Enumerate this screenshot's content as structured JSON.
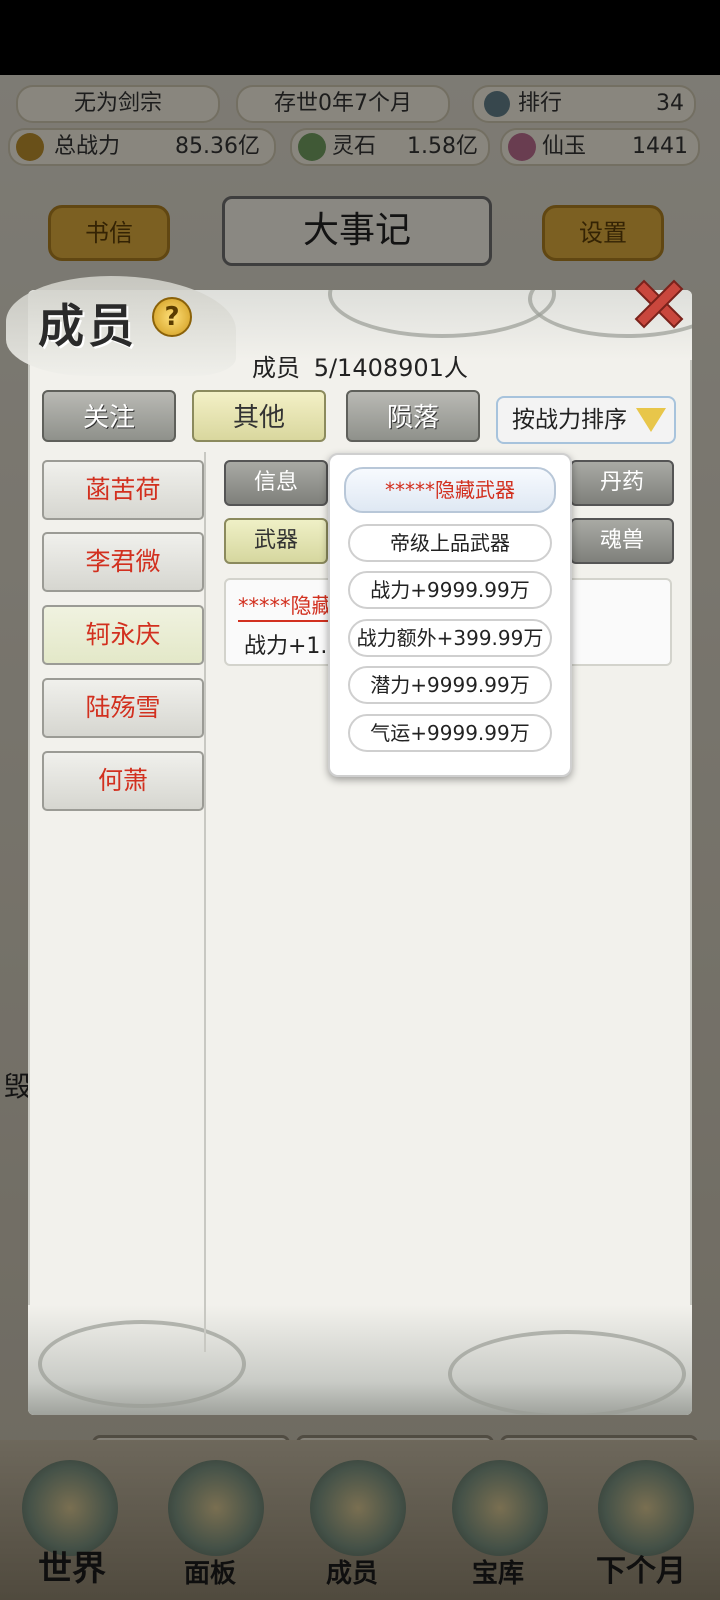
{
  "background_screen": {
    "sect_name": "无为剑宗",
    "age_text": "存世0年7个月",
    "rank_label": "排行",
    "rank_value": "34",
    "power_label": "总战力",
    "power_value": "85.36亿",
    "spirit_stone_label": "灵石",
    "spirit_stone_value": "1.58亿",
    "jade_label": "仙玉",
    "jade_value": "1441",
    "letters_button": "书信",
    "events_title": "大事记",
    "settings_button": "设置",
    "partial_char": "毁",
    "bottom_nav": [
      "世界",
      "面板",
      "成员",
      "宝库",
      "下个月"
    ]
  },
  "members_panel": {
    "title": "成员",
    "count_label": "成员",
    "count_value": "5/1408901人",
    "tabs": [
      {
        "label": "关注",
        "active": false
      },
      {
        "label": "其他",
        "active": true
      },
      {
        "label": "陨落",
        "active": false
      }
    ],
    "sort_label": "按战力排序",
    "members": [
      {
        "name": "菡苦荷",
        "selected": false
      },
      {
        "name": "李君微",
        "selected": false
      },
      {
        "name": "轲永庆",
        "selected": true
      },
      {
        "name": "陆殇雪",
        "selected": false
      },
      {
        "name": "何萧",
        "selected": false
      }
    ],
    "subtabs_row1": [
      "信息",
      "丹药"
    ],
    "subtabs_row2": [
      "武器",
      "魂兽"
    ],
    "active_subtab": "武器",
    "item": {
      "name": "*****隐藏",
      "stat": "战力+1.0"
    },
    "popover": {
      "items": [
        "*****隐藏武器",
        "帝级上品武器",
        "战力+9999.99万",
        "战力额外+399.99万",
        "潜力+9999.99万",
        "气运+9999.99万"
      ]
    }
  },
  "colors": {
    "name_red": "#d2301f",
    "active_tab": "#e6e3b0",
    "gold": "#d6a53b"
  }
}
